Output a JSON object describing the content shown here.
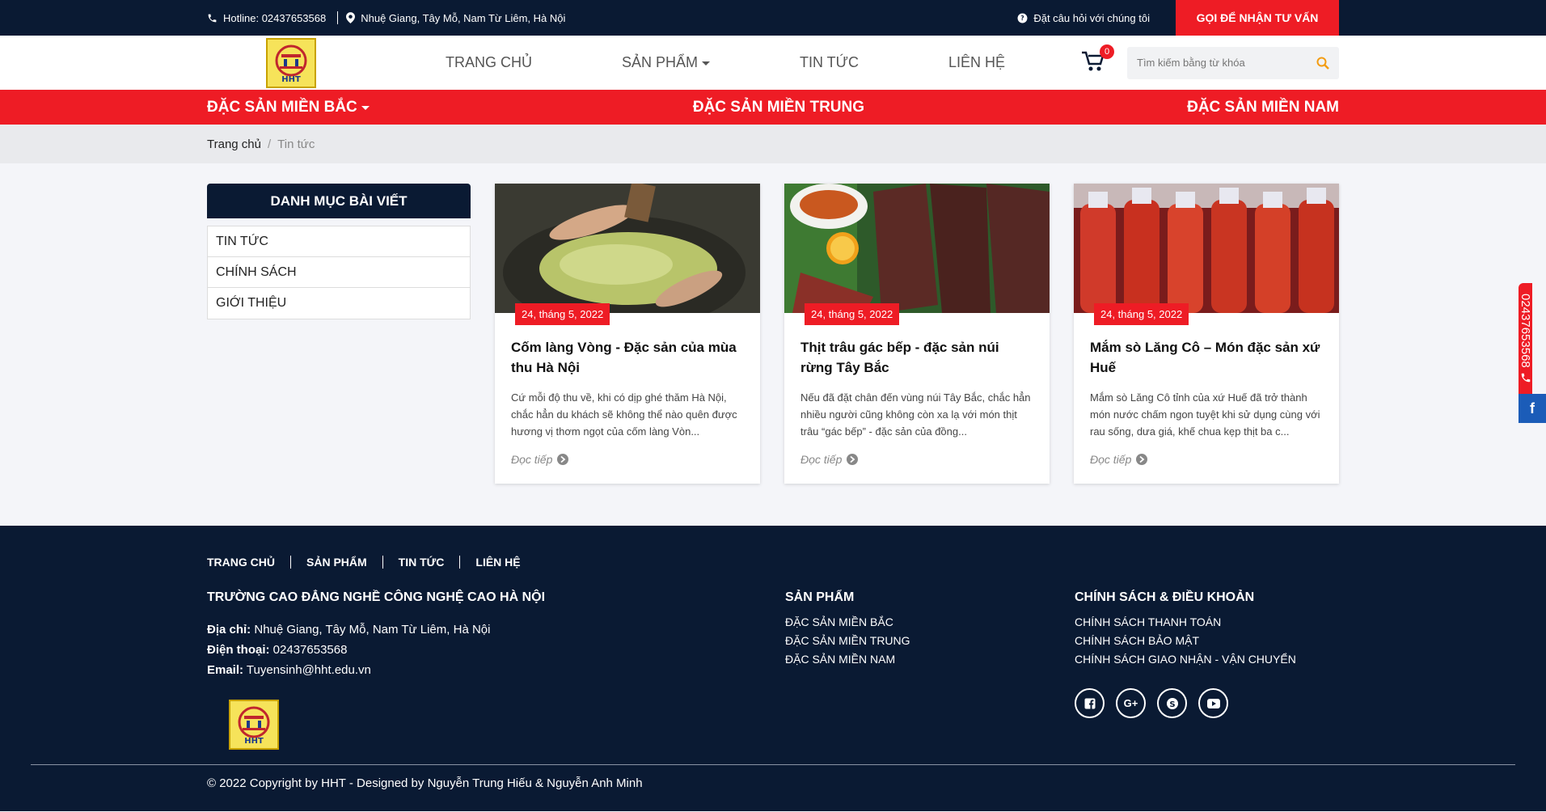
{
  "topbar": {
    "hotline": "Hotline: 02437653568",
    "address": "Nhuệ Giang, Tây Mỗ, Nam Từ Liêm, Hà Nội",
    "question": "Đặt câu hỏi với chúng tôi",
    "cta": "GỌI ĐỂ NHẬN TƯ VẤN"
  },
  "header": {
    "logo_text": "HHT",
    "nav": [
      "TRANG CHỦ",
      "SẢN PHẨM",
      "TIN TỨC",
      "LIÊN HỆ"
    ],
    "cart_count": "0",
    "search_placeholder": "Tìm kiếm bằng từ khóa"
  },
  "catbar": [
    "ĐẶC SẢN MIỀN BẮC",
    "ĐẶC SẢN MIỀN TRUNG",
    "ĐẶC SẢN MIỀN NAM"
  ],
  "breadcrumb": {
    "home": "Trang chủ",
    "sep": "/",
    "current": "Tin tức"
  },
  "sidebar": {
    "title": "DANH MỤC BÀI VIẾT",
    "items": [
      "TIN TỨC",
      "CHÍNH SÁCH",
      "GIỚI THIỆU"
    ]
  },
  "cards": [
    {
      "date": "24, tháng 5, 2022",
      "title": "Cốm làng Vòng - Đặc sản của mùa thu Hà Nội",
      "excerpt": "Cứ mỗi độ thu về, khi có dịp ghé thăm Hà Nội, chắc hẳn du khách sẽ không thể nào quên được hương vị thơm ngọt của cốm làng Vòn...",
      "more": "Đọc tiếp"
    },
    {
      "date": "24, tháng 5, 2022",
      "title": "Thịt trâu gác bếp - đặc sản núi rừng Tây Bắc",
      "excerpt": "Nếu đã đặt chân đến vùng núi Tây Bắc, chắc hẳn nhiều người cũng không còn xa lạ với món thịt trâu “gác bếp” - đặc sản của đồng...",
      "more": "Đọc tiếp"
    },
    {
      "date": "24, tháng 5, 2022",
      "title": "Mắm sò Lăng Cô – Món đặc sản xứ Huế",
      "excerpt": "Mắm sò Lăng Cô tỉnh của xứ Huế đã trở thành món nước chấm ngon tuyệt khi sử dụng cùng với rau sống, dưa giá, khế chua kẹp thịt ba c...",
      "more": "Đọc tiếp"
    }
  ],
  "footer": {
    "nav": [
      "TRANG CHỦ",
      "SẢN PHẨM",
      "TIN TỨC",
      "LIÊN HỆ"
    ],
    "school": "TRƯỜNG CAO ĐẲNG NGHỀ CÔNG NGHỆ CAO HÀ NỘI",
    "address_label": "Địa chỉ:",
    "address": "Nhuệ Giang, Tây Mỗ, Nam Từ Liêm, Hà Nội",
    "phone_label": "Điện thoại:",
    "phone": "02437653568",
    "email_label": "Email:",
    "email": "Tuyensinh@hht.edu.vn",
    "logo_text": "HHT",
    "products_title": "SẢN PHẨM",
    "products": [
      "ĐẶC SẢN MIỀN BẮC",
      "ĐẶC SẢN MIỀN TRUNG",
      "ĐẶC SẢN MIỀN NAM"
    ],
    "policy_title": "CHÍNH SÁCH & ĐIỀU KHOẢN",
    "policies": [
      "CHÍNH SÁCH THANH TOÁN",
      "CHÍNH SÁCH BẢO MẬT",
      "CHÍNH SÁCH GIAO NHẬN - VẬN CHUYỂN"
    ],
    "copyright": "© 2022 Copyright by HHT - Designed by Nguyễn Trung Hiếu & Nguyễn Anh Minh"
  },
  "float": {
    "phone": "02437653568",
    "fb": "f"
  },
  "colors": {
    "navy": "#0a1a33",
    "red": "#ee1c25",
    "blue": "#1b5cb8"
  }
}
